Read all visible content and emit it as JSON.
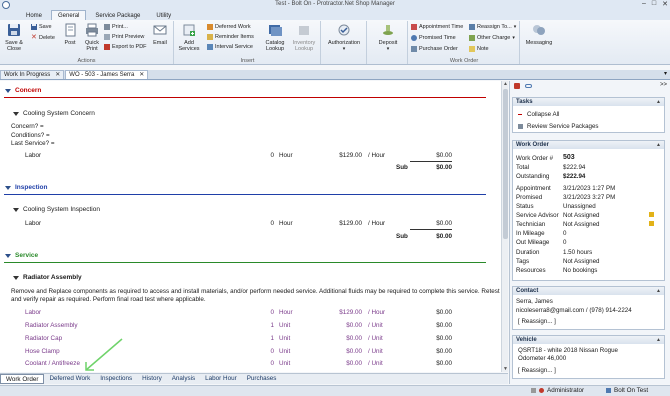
{
  "window": {
    "title": "Test - Bolt On - Protractor.Net Shop Manager"
  },
  "ribbon_tabs": [
    "Home",
    "General",
    "Service Package",
    "Utility"
  ],
  "ribbon": {
    "actions": {
      "label": "Actions",
      "save_close": "Save & Close",
      "save": "Save",
      "delete": "Delete",
      "post": "Post",
      "quick_print": "Quick Print",
      "print": "Print...",
      "print_preview": "Print Preview",
      "export_pdf": "Export to PDF",
      "email": "Email"
    },
    "insert": {
      "label": "Insert",
      "add_services": "Add Services",
      "deferred_work": "Deferred Work",
      "reminder_items": "Reminder Items",
      "interval_service": "Interval Service",
      "catalog_lookup": "Catalog Lookup",
      "inventory_lookup": "Inventory Lookup"
    },
    "authorization": {
      "label": "Authorization"
    },
    "deposit": {
      "label": "Deposit"
    },
    "work_order": {
      "label": "Work Order",
      "appointment_time": "Appointment Time",
      "promised_time": "Promised Time",
      "purchase_order": "Purchase Order",
      "reassign_to": "Reassign To...",
      "other_charge": "Other Charge",
      "note": "Note"
    },
    "messaging": {
      "label": "Messaging"
    }
  },
  "doc_tabs": [
    {
      "label": "Work In Progress"
    },
    {
      "label": "WO - 503 - James Serra"
    }
  ],
  "main": {
    "concern": {
      "title": "Concern",
      "color": "#c00000",
      "sub": "Cooling System Concern",
      "concern_label": "Concern?  =",
      "conditions_label": "Conditions?  =",
      "last_service_label": "Last Service?  =",
      "labor_row": {
        "name": "Labor",
        "qty": "0",
        "unit": "Hour",
        "rate": "$129.00",
        "per": "/ Hour",
        "amount": "$0.00"
      },
      "sub_label": "Sub",
      "sub_total": "$0.00"
    },
    "inspection": {
      "title": "Inspection",
      "color": "#1f3fa8",
      "sub": "Cooling System Inspection",
      "labor_row": {
        "name": "Labor",
        "qty": "0",
        "unit": "Hour",
        "rate": "$129.00",
        "per": "/ Hour",
        "amount": "$0.00"
      },
      "sub_label": "Sub",
      "sub_total": "$0.00"
    },
    "service": {
      "title": "Service",
      "color": "#2a8a2a",
      "sub": "Radiator Assembly",
      "description_line1": "Remove and Replace components as required to access and install materials, and/or perform needed service.  Additional fluids may be required to complete this service.   Retest",
      "description_line2": "and verify repair as required.  Perform final road test where applicable.",
      "rows": [
        {
          "name": "Labor",
          "qty": "0",
          "unit": "Hour",
          "rate": "$129.00",
          "per": "/ Hour",
          "amount": "$0.00"
        },
        {
          "name": "Radiator Assembly",
          "qty": "1",
          "unit": "Unit",
          "rate": "$0.00",
          "per": "/ Unit",
          "amount": "$0.00"
        },
        {
          "name": "Radiator Cap",
          "qty": "1",
          "unit": "Unit",
          "rate": "$0.00",
          "per": "/ Unit",
          "amount": "$0.00"
        },
        {
          "name": "Hose Clamp",
          "qty": "0",
          "unit": "Unit",
          "rate": "$0.00",
          "per": "/ Unit",
          "amount": "$0.00"
        },
        {
          "name": "Coolant / Antifreeze",
          "qty": "0",
          "unit": "Unit",
          "rate": "$0.00",
          "per": "/ Unit",
          "amount": "$0.00"
        }
      ]
    }
  },
  "bottom_tabs": [
    "Work Order",
    "Deferred Work",
    "Inspections",
    "History",
    "Analysis",
    "Labor Hour",
    "Purchases"
  ],
  "tasks": {
    "header": "Tasks",
    "collapse_all": "Collapse All",
    "review_service_packages": "Review Service Packages"
  },
  "work_order_panel": {
    "header": "Work Order",
    "fields": [
      {
        "label": "Work Order #",
        "value": "503"
      },
      {
        "label": "Total",
        "value": "$222.94"
      },
      {
        "label": "Outstanding",
        "value": "$222.94"
      },
      {
        "label": "Appointment",
        "value": "3/21/2023 1:27 PM"
      },
      {
        "label": "Promised",
        "value": "3/21/2023 3:27 PM"
      },
      {
        "label": "Status",
        "value": "Unassigned"
      },
      {
        "label": "Service Advisor",
        "value": "Not Assigned"
      },
      {
        "label": "Technician",
        "value": "Not Assigned"
      },
      {
        "label": "In Mileage",
        "value": "0"
      },
      {
        "label": "Out Mileage",
        "value": "0"
      },
      {
        "label": "Duration",
        "value": "1.50 hours"
      },
      {
        "label": "Tags",
        "value": "Not Assigned"
      },
      {
        "label": "Resources",
        "value": "No bookings"
      }
    ]
  },
  "contact_panel": {
    "header": "Contact",
    "name": "Serra, James",
    "email_phone": "nicoleserra8@gmail.com / (978) 914-2224",
    "reassign": "[ Reassign... ]"
  },
  "vehicle_panel": {
    "header": "Vehicle",
    "line1": "QSRT18 - white 2018 Nissan Rogue",
    "line2": "Odometer 46,000",
    "reassign": "[ Reassign... ]"
  },
  "statusbar": {
    "user": "Administrator",
    "location": "Bolt On Test"
  }
}
